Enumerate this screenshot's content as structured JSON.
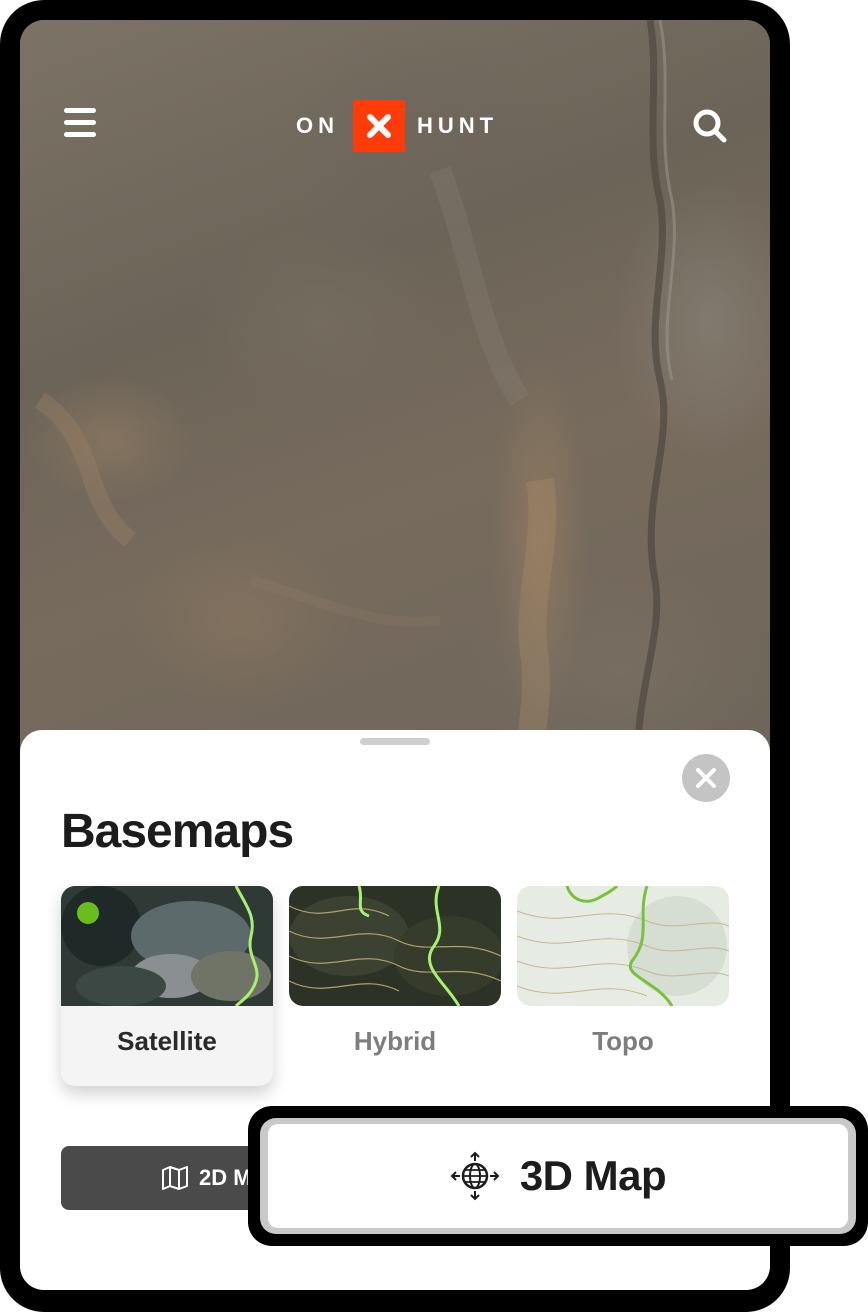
{
  "header": {
    "logo_left": "ON",
    "logo_right": "HUNT",
    "logo_mark": "x-icon",
    "menu_icon": "hamburger-menu-icon",
    "search_icon": "search-icon"
  },
  "colors": {
    "brand_orange": "#ff3b0a",
    "selected_dot": "#6bbd1c",
    "button_dark": "#4a4a4a"
  },
  "sheet": {
    "title": "Basemaps",
    "close_icon": "close-icon",
    "basemaps": [
      {
        "label": "Satellite",
        "selected": true
      },
      {
        "label": "Hybrid",
        "selected": false
      },
      {
        "label": "Topo",
        "selected": false
      }
    ],
    "btn_2d_label": "2D M",
    "btn_2d_icon": "map-icon"
  },
  "highlight": {
    "btn_3d_label": "3D Map",
    "btn_3d_icon": "globe-move-icon"
  }
}
